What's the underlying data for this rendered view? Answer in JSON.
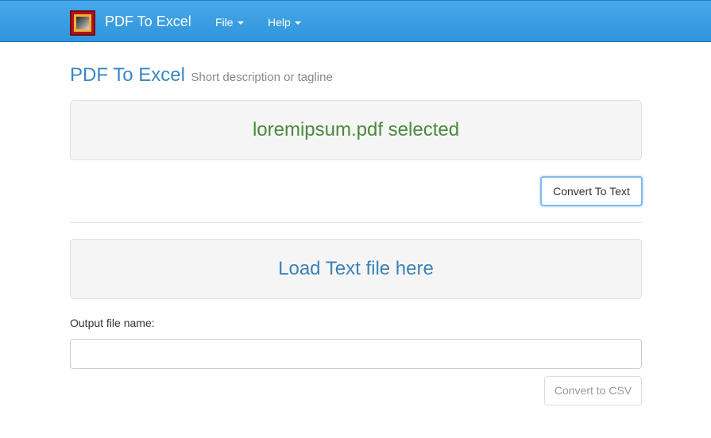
{
  "navbar": {
    "brand_name": "PDF To Excel",
    "menu": [
      {
        "label": "File"
      },
      {
        "label": "Help"
      }
    ],
    "colors": {
      "background": "#3a9de2",
      "text": "#ffffff"
    }
  },
  "header": {
    "title": "PDF To Excel",
    "tagline": "Short description or tagline"
  },
  "pdf_dropzone": {
    "status_text": "loremipsum.pdf selected",
    "color": "#4a8a3c"
  },
  "convert_text_button": {
    "label": "Convert To Text"
  },
  "text_dropzone": {
    "prompt": "Load Text file here",
    "color": "#3e82b6"
  },
  "output": {
    "label": "Output file name:",
    "value": "",
    "placeholder": ""
  },
  "convert_csv_button": {
    "label": "Convert to CSV",
    "state": "disabled"
  }
}
